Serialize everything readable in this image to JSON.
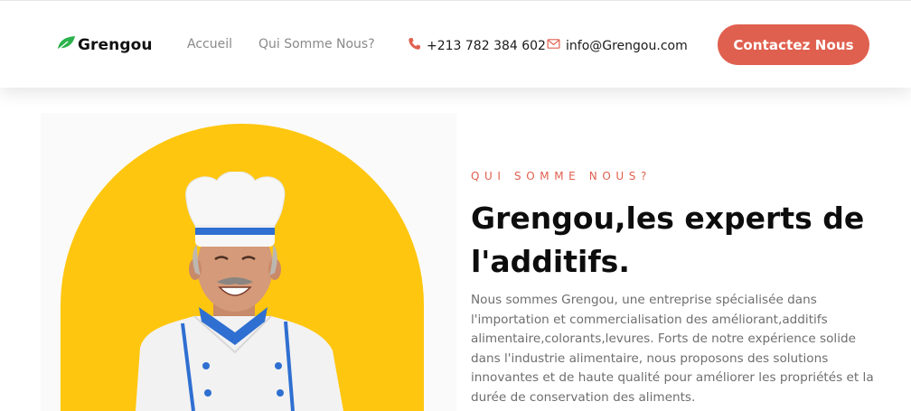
{
  "header": {
    "logo_text": "Grengou",
    "nav": [
      {
        "label": "Accueil"
      },
      {
        "label": "Qui Somme Nous?"
      }
    ],
    "phone": "+213 782 384 602",
    "email": "info@Grengou.com",
    "cta_label": "Contactez Nous"
  },
  "hero": {
    "eyebrow": "QUI SOMME NOUS?",
    "title": "Grengou,les experts de l'additifs.",
    "paragraph": "Nous sommes Grengou, une entreprise spécialisée dans l'importation et commercialisation des améliorant,additifs alimentaire,colorants,levures. Forts de notre expérience solide dans l'industrie alimentaire, nous proposons des solutions innovantes et de haute qualité pour améliorer les propriétés et la durée de conservation des aliments."
  },
  "colors": {
    "accent": "#e0604f",
    "brand_green": "#2bb24c",
    "yellow": "#ffc60f"
  },
  "icons": [
    "leaf-icon",
    "phone-icon",
    "mail-icon"
  ]
}
